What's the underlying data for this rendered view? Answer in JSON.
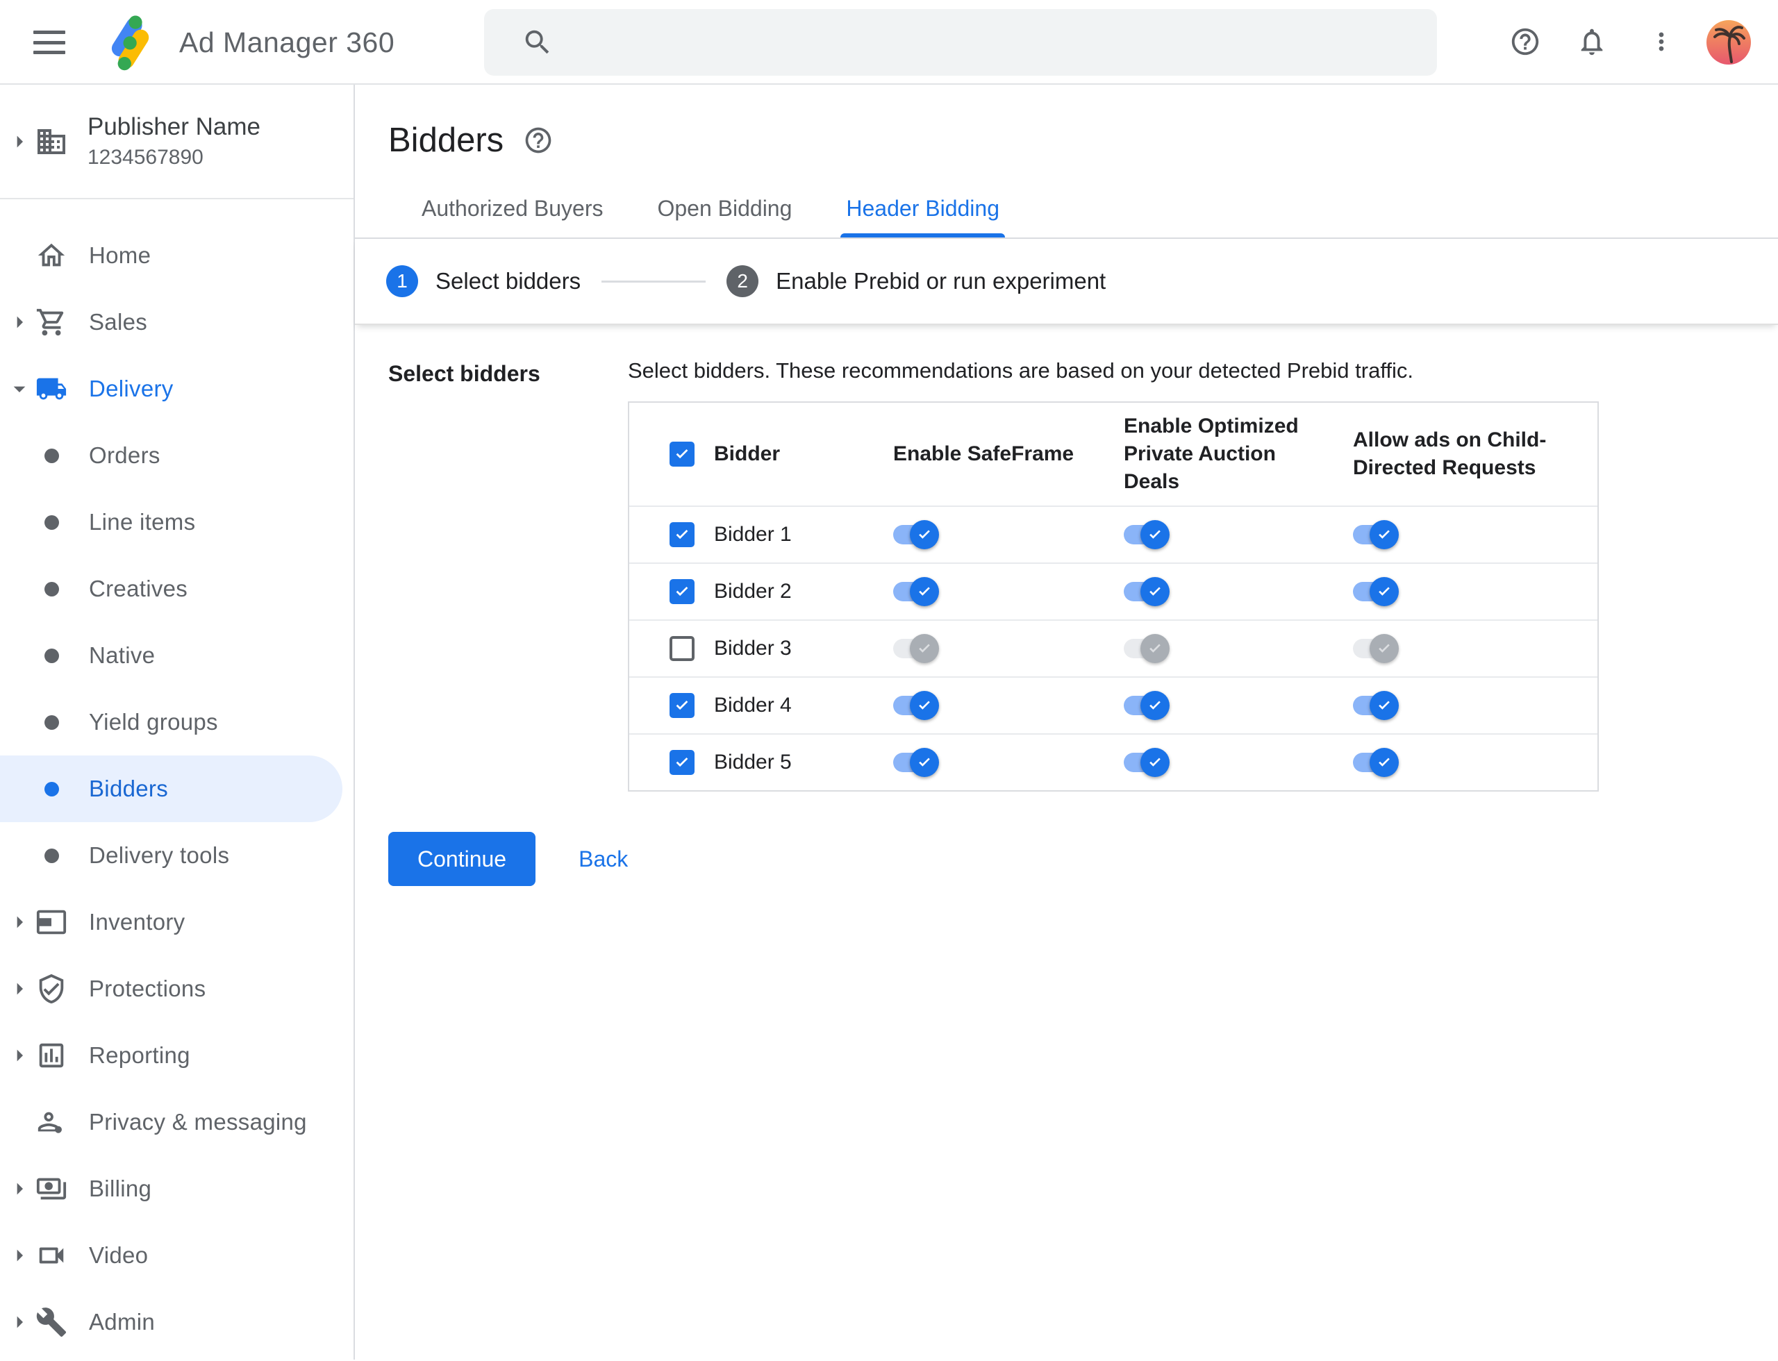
{
  "topbar": {
    "app_title": "Ad Manager 360",
    "search": {
      "placeholder": "",
      "value": ""
    }
  },
  "sidebar": {
    "publisher": {
      "name": "Publisher Name",
      "id": "1234567890"
    },
    "items": [
      {
        "label": "Home",
        "icon": "home"
      },
      {
        "label": "Sales",
        "icon": "cart",
        "caret": "right"
      },
      {
        "label": "Delivery",
        "icon": "truck",
        "caret": "down",
        "active": true
      },
      {
        "label": "Orders",
        "icon": "dot",
        "sub": true
      },
      {
        "label": "Line items",
        "icon": "dot",
        "sub": true
      },
      {
        "label": "Creatives",
        "icon": "dot",
        "sub": true
      },
      {
        "label": "Native",
        "icon": "dot",
        "sub": true
      },
      {
        "label": "Yield groups",
        "icon": "dot",
        "sub": true
      },
      {
        "label": "Bidders",
        "icon": "dot",
        "sub": true,
        "selected": true
      },
      {
        "label": "Delivery tools",
        "icon": "dot",
        "sub": true
      },
      {
        "label": "Inventory",
        "icon": "adunit",
        "caret": "right"
      },
      {
        "label": "Protections",
        "icon": "shield",
        "caret": "right"
      },
      {
        "label": "Reporting",
        "icon": "chart",
        "caret": "right"
      },
      {
        "label": "Privacy & messaging",
        "icon": "person"
      },
      {
        "label": "Billing",
        "icon": "money",
        "caret": "right"
      },
      {
        "label": "Video",
        "icon": "video",
        "caret": "right"
      },
      {
        "label": "Admin",
        "icon": "wrench",
        "caret": "right"
      }
    ]
  },
  "page": {
    "title": "Bidders",
    "tabs": [
      {
        "label": "Authorized Buyers",
        "active": false
      },
      {
        "label": "Open Bidding",
        "active": false
      },
      {
        "label": "Header Bidding",
        "active": true
      }
    ],
    "stepper": [
      {
        "num": "1",
        "label": "Select bidders",
        "state": "current"
      },
      {
        "num": "2",
        "label": "Enable Prebid or run experiment",
        "state": "upcoming"
      }
    ]
  },
  "content": {
    "section_label": "Select bidders",
    "description": "Select bidders. These recommendations are based on your detected Prebid traffic.",
    "table": {
      "columns": [
        "Bidder",
        "Enable SafeFrame",
        "Enable Optimized Private Auction Deals",
        "Allow ads on Child-Directed Requests"
      ],
      "header_checkbox_checked": true,
      "rows": [
        {
          "name": "Bidder 1",
          "checked": true,
          "safeframe": true,
          "optimized_private_auction": true,
          "child_directed": true
        },
        {
          "name": "Bidder 2",
          "checked": true,
          "safeframe": true,
          "optimized_private_auction": true,
          "child_directed": true
        },
        {
          "name": "Bidder 3",
          "checked": false,
          "safeframe": false,
          "optimized_private_auction": false,
          "child_directed": false
        },
        {
          "name": "Bidder 4",
          "checked": true,
          "safeframe": true,
          "optimized_private_auction": true,
          "child_directed": true
        },
        {
          "name": "Bidder 5",
          "checked": true,
          "safeframe": true,
          "optimized_private_auction": true,
          "child_directed": true
        }
      ]
    },
    "actions": {
      "continue_label": "Continue",
      "back_label": "Back"
    }
  },
  "colors": {
    "accent": "#1a73e8",
    "selected_item_bg": "#e8f0fe",
    "selected_item_text": "#1967d2",
    "toggle_on_track": "#8ab4f8",
    "toggle_off_track": "#e9ebee",
    "toggle_off_thumb": "#a9aeb4",
    "step_upcoming": "#5f6368"
  }
}
